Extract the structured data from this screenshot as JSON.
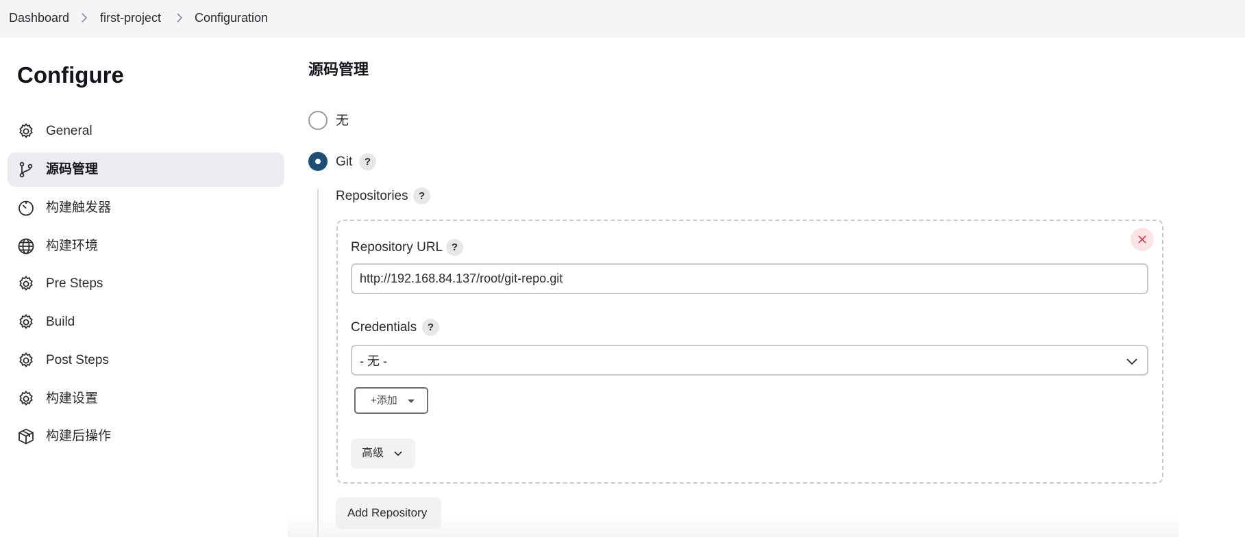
{
  "breadcrumb": {
    "items": [
      "Dashboard",
      "first-project",
      "Configuration"
    ]
  },
  "sidebar": {
    "title": "Configure",
    "items": [
      {
        "label": "General",
        "icon": "gear-icon"
      },
      {
        "label": "源码管理",
        "icon": "branch-icon",
        "active": true
      },
      {
        "label": "构建触发器",
        "icon": "timer-icon"
      },
      {
        "label": "构建环境",
        "icon": "globe-icon"
      },
      {
        "label": "Pre Steps",
        "icon": "gear-icon"
      },
      {
        "label": "Build",
        "icon": "gear-icon"
      },
      {
        "label": "Post Steps",
        "icon": "gear-icon"
      },
      {
        "label": "构建设置",
        "icon": "gear-icon"
      },
      {
        "label": "构建后操作",
        "icon": "package-icon"
      }
    ]
  },
  "scm": {
    "title": "源码管理",
    "options": [
      {
        "label": "无",
        "selected": false
      },
      {
        "label": "Git",
        "selected": true
      }
    ],
    "help_glyph": "?",
    "repositories_label": "Repositories",
    "repo_url_label": "Repository URL",
    "repo_url_value": "http://192.168.84.137/root/git-repo.git",
    "credentials_label": "Credentials",
    "credentials_value": "- 无 -",
    "add_button_label": "+添加",
    "advanced_label": "高级",
    "add_repository_label": "Add Repository"
  },
  "colors": {
    "accent": "#1f4d73",
    "delete": "#d33a47",
    "breadcrumb_bg": "#f5f5f7",
    "active_item_bg": "#ececf0"
  }
}
